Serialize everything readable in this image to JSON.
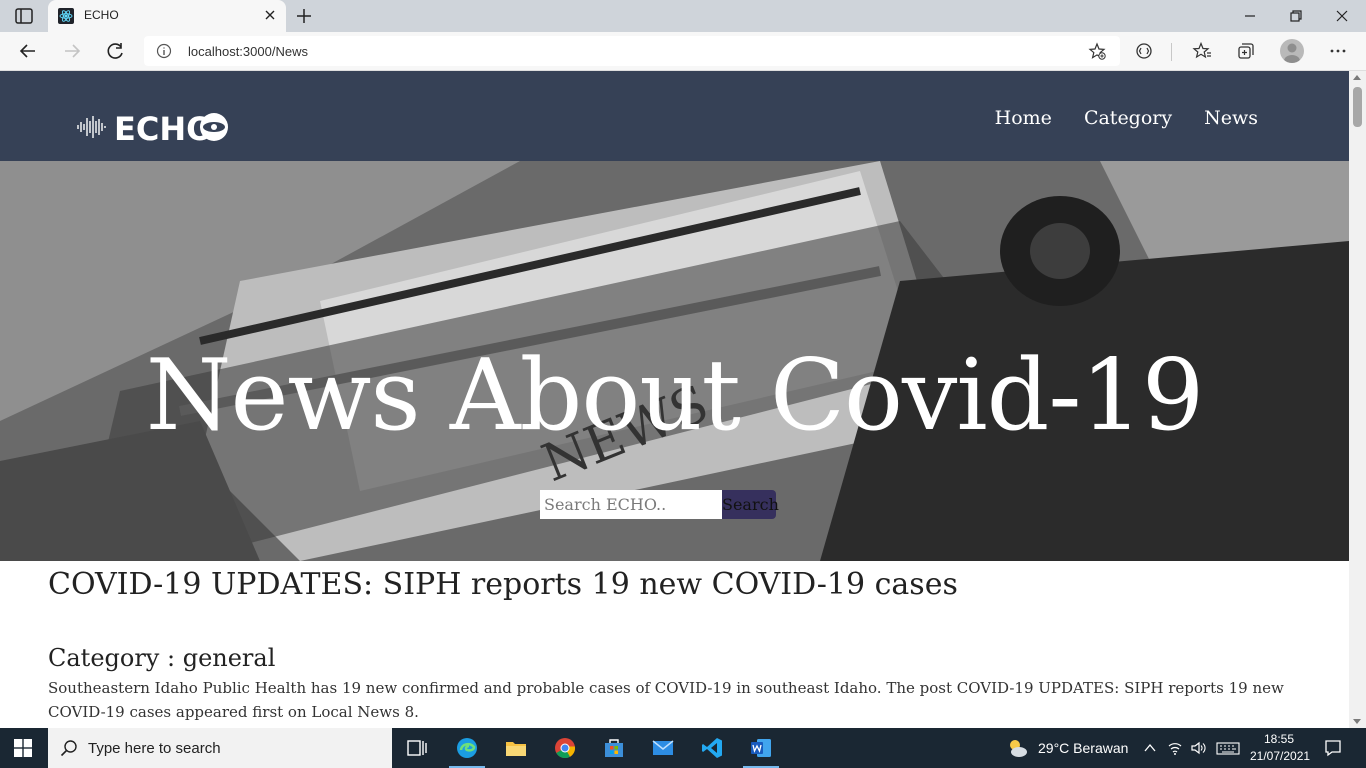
{
  "browser": {
    "tab_title": "ECHO",
    "url": "localhost:3000/News"
  },
  "site": {
    "logo_text": "ECHO",
    "nav": [
      "Home",
      "Category",
      "News"
    ]
  },
  "hero": {
    "title": "News About Covid-19",
    "search_placeholder": "Search ECHO..",
    "search_button": "Search"
  },
  "article": {
    "title": "COVID-19 UPDATES: SIPH reports 19 new COVID-19 cases",
    "category": "Category : general",
    "description": "Southeastern Idaho Public Health has 19 new confirmed and probable cases of COVID-19 in southeast Idaho. The post COVID-19 UPDATES: SIPH reports 19 new COVID-19 cases appeared first on Local News 8."
  },
  "taskbar": {
    "search_placeholder": "Type here to search",
    "weather": "29°C  Berawan",
    "time": "18:55",
    "date": "21/07/2021"
  },
  "colors": {
    "navbar": "#364156",
    "search_button": "#36305d",
    "taskbar": "#1a2733"
  }
}
